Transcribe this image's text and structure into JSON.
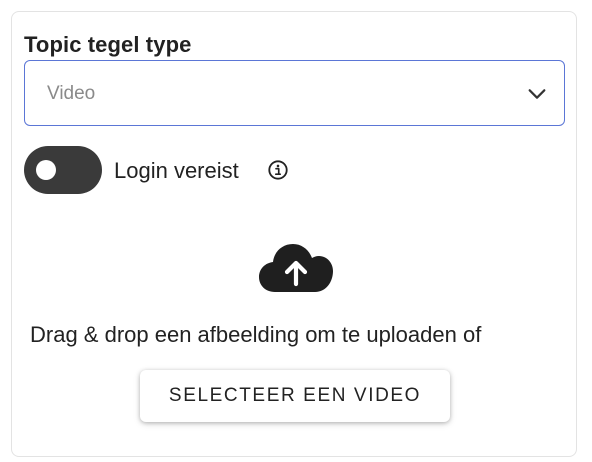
{
  "topic_tile": {
    "title": "Topic tegel type",
    "select": {
      "value": "Video",
      "icon": "chevron-down-icon"
    }
  },
  "login_toggle": {
    "label": "Login vereist",
    "state": "off",
    "info_icon": "info-icon"
  },
  "upload": {
    "icon": "cloud-upload-icon",
    "instruction": "Drag & drop een afbeelding om te uploaden of",
    "button_label": "SELECTEER EEN VIDEO"
  },
  "colors": {
    "select_border": "#5b76d6",
    "toggle_background": "#3a3a3a",
    "text": "#222222",
    "placeholder": "#8a8a8a"
  }
}
